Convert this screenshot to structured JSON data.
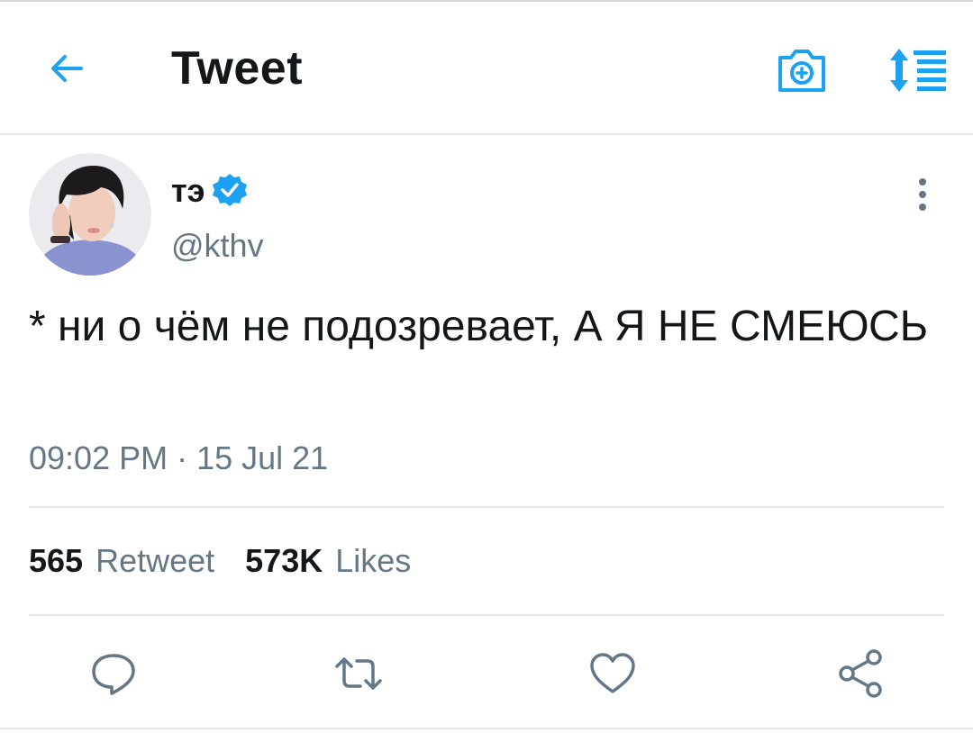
{
  "header": {
    "title": "Tweet",
    "back_icon": "arrow-left-icon",
    "camera_icon": "camera-plus-icon",
    "sort_icon": "sort-list-icon",
    "accent_color": "#1da1f2"
  },
  "tweet": {
    "display_name": "тэ",
    "verified": true,
    "handle": "@kthv",
    "text": "* ни о чём не подозревает, А Я НЕ СМЕЮСЬ",
    "timestamp": "09:02 PM · 15 Jul 21"
  },
  "stats": {
    "retweets_count": "565",
    "retweets_label": "Retweet",
    "likes_count": "573K",
    "likes_label": "Likes"
  },
  "actions": [
    "reply-icon",
    "retweet-icon",
    "like-icon",
    "share-icon"
  ],
  "colors": {
    "text_primary": "#14171a",
    "text_secondary": "#657786",
    "divider": "#e1e8ed",
    "verified": "#1da1f2"
  }
}
